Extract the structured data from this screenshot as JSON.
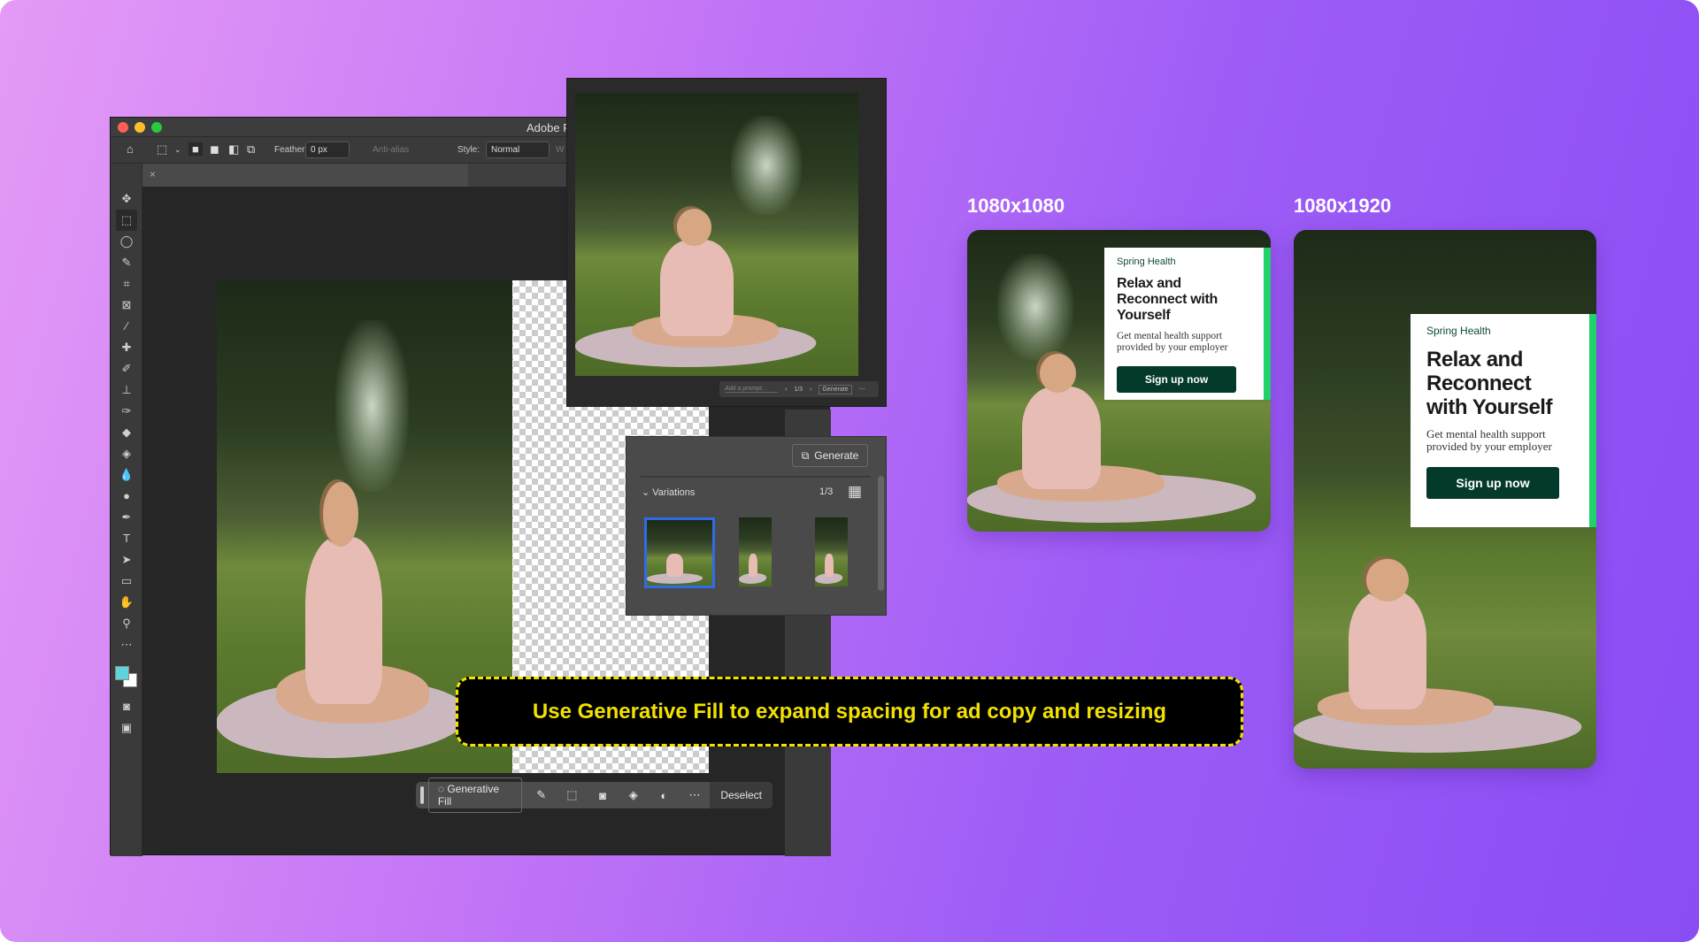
{
  "photoshop": {
    "title": "Adobe P",
    "options": {
      "feather_label": "Feather:",
      "feather_value": "0 px",
      "antialias_label": "Anti-alias",
      "style_label": "Style:",
      "style_value": "Normal",
      "width_label": "W"
    },
    "tools": [
      "move",
      "marquee",
      "lasso",
      "quick-select",
      "crop",
      "frame",
      "eyedropper",
      "healing",
      "brush",
      "stamp",
      "history-brush",
      "eraser",
      "paint-bucket",
      "blur",
      "dodge",
      "pen",
      "type",
      "path-select",
      "rectangle",
      "hand",
      "zoom",
      "more"
    ],
    "colors": {
      "foreground": "#5fd3d9",
      "background": "#ffffff"
    },
    "prompt_bar": {
      "placeholder": "Add a prompt...",
      "page": "1/3",
      "generate": "Generate"
    },
    "variations": {
      "generate": "Generate",
      "label": "Variations",
      "page": "1/3"
    },
    "contextual_bar": {
      "generative_fill": "Generative Fill",
      "deselect": "Deselect"
    }
  },
  "banner": "Use Generative Fill to expand spacing for ad copy and resizing",
  "ads": [
    {
      "size": "1080x1080",
      "brand": "Spring Health",
      "headline": "Relax and Reconnect with Yourself",
      "body": "Get mental health support provided by your employer",
      "cta": "Sign up now"
    },
    {
      "size": "1080x1920",
      "brand": "Spring Health",
      "headline": "Relax and Reconnect with Yourself",
      "body": "Get mental health support provided by your employer",
      "cta": "Sign up now"
    }
  ],
  "accent": {
    "banner_yellow": "#f2e100",
    "brand_green": "#043a2b",
    "stripe_green": "#1fd26a"
  }
}
